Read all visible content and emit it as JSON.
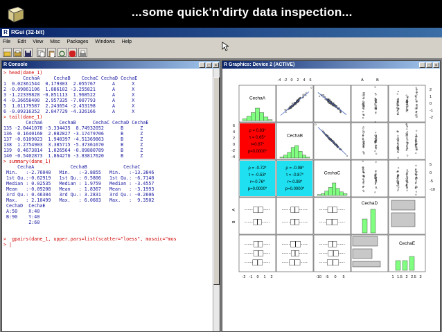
{
  "slide": {
    "title": "...some quick'n'dirty data inspection..."
  },
  "app": {
    "title": "RGui (32-bit)"
  },
  "menu": [
    "File",
    "Edit",
    "View",
    "Misc",
    "Packages",
    "Windows",
    "Help"
  ],
  "toolbar": {
    "icons": [
      "open-icon",
      "load-icon",
      "save-icon",
      "copy-icon",
      "paste-icon",
      "copy-paste-icon",
      "stop-icon",
      "print-icon"
    ]
  },
  "console": {
    "title": "R Console",
    "lines": [
      {
        "kind": "cmd",
        "text": "> head(dane_1)"
      },
      {
        "kind": "out",
        "text": "       CechaA     CechaB    CechaC CechaD CechaE"
      },
      {
        "kind": "out",
        "text": "1  0.02361544  0.179303  2.055767      A      X"
      },
      {
        "kind": "out",
        "text": "2 -0.09861106  1.886102 -3.255821      A      X"
      },
      {
        "kind": "out",
        "text": "3 -1.22339828 -0.851113  1.968522      A      X"
      },
      {
        "kind": "out",
        "text": "4 -0.36658400  2.957335 -7.007793      A      X"
      },
      {
        "kind": "out",
        "text": "5  1.01179587  2.243654 -2.453198      A      X"
      },
      {
        "kind": "out",
        "text": "6 -0.09316352  2.047729 -4.326166      A      X"
      },
      {
        "kind": "cmd",
        "text": "> tail(dane_1)"
      },
      {
        "kind": "out",
        "text": "        CechaA      CechaB      CechaC CechaD CechaE"
      },
      {
        "kind": "out",
        "text": "135 -2.0441078 -3.334435  8.74932052      B      Z"
      },
      {
        "kind": "out",
        "text": "136  0.1640160  2.082827 -3.17479706      B      Z"
      },
      {
        "kind": "out",
        "text": "137 -0.6109023  1.940397 -4.51369863      B      Z"
      },
      {
        "kind": "out",
        "text": "138  1.2754903  3.385715 -5.37361670      B      Z"
      },
      {
        "kind": "out",
        "text": "139  0.4673814  1.026564 -0.09880789      B      Z"
      },
      {
        "kind": "out",
        "text": "140 -0.5402873  1.864276 -3.83817620      B      Z"
      },
      {
        "kind": "cmd",
        "text": "> summary(dane_1)"
      },
      {
        "kind": "out",
        "text": "     CechaA             CechaB             CechaC"
      },
      {
        "kind": "out",
        "text": " Min.   :-2.76040   Min.   :-3.8855   Min.   :-13.3846"
      },
      {
        "kind": "out",
        "text": " 1st Qu.:-0.62919   1st Qu.: 0.5806   1st Qu.: -6.7140"
      },
      {
        "kind": "out",
        "text": " Median : 0.02535   Median : 1.9759   Median : -3.4557"
      },
      {
        "kind": "out",
        "text": " Mean   :-0.09208   Mean   : 1.8367   Mean   : -3.1993"
      },
      {
        "kind": "out",
        "text": " 3rd Qu.: 0.46304   3rd Qu.: 3.2831   3rd Qu.: -0.2606"
      },
      {
        "kind": "out",
        "text": " Max.   : 2.10499   Max.   : 6.0683   Max.   :  9.3502"
      },
      {
        "kind": "out",
        "text": " CechaD  CechaE"
      },
      {
        "kind": "out",
        "text": " A:50    X:40"
      },
      {
        "kind": "out",
        "text": " B:90    Y:40"
      },
      {
        "kind": "out",
        "text": "         Z:60"
      },
      {
        "kind": "out",
        "text": ""
      },
      {
        "kind": "out",
        "text": ""
      },
      {
        "kind": "cmd",
        "text": ">  gpairs(dane_1, upper.pars=list(scatter=\"loess\", mosaic=\"mos"
      },
      {
        "kind": "cmd",
        "text": "> |"
      }
    ]
  },
  "graphics": {
    "title": "R Graphics: Device 2 (ACTIVE)",
    "var_labels": [
      "CechaA",
      "CechaB",
      "CechaC",
      "CechaD",
      "CechaE"
    ],
    "corr_AB": [
      "ρ = 0.83*",
      "τ = 0.65*",
      "r=0.87*",
      "p=0.0000*"
    ],
    "corr_AC": [
      "ρ = -0.72*",
      "τ = -0.53*",
      "r=-0.76*",
      "p=0.0000*"
    ],
    "corr_BC": [
      "ρ = -0.98*",
      "τ = -0.87*",
      "r=-0.98*",
      "p=0.0000*"
    ],
    "top_axis_A": [
      "-4",
      "-2",
      "0",
      "2",
      "4",
      "6"
    ],
    "top_axis_D": [
      "A",
      "B"
    ],
    "right_axis_A": [
      "2",
      "1",
      "0",
      "-1",
      "-2"
    ],
    "left_axis_B": [
      "6",
      "4",
      "2",
      "0",
      "-2",
      "-4"
    ],
    "right_axis_C": [
      "5",
      "0",
      "-5",
      "-10"
    ],
    "left_axis_D": [
      "A",
      "B"
    ],
    "bottom_axis_A": [
      "-2",
      "-1",
      "0",
      "1",
      "2"
    ],
    "bottom_axis_C": [
      "-10",
      "-5",
      "0",
      "5"
    ],
    "bottom_axis_E": [
      "1",
      "1.5",
      "2",
      "2.5",
      "3"
    ],
    "colors": {
      "red": "#ff0000",
      "cyan": "#1ee0f0",
      "hist": "#80ff80"
    }
  }
}
